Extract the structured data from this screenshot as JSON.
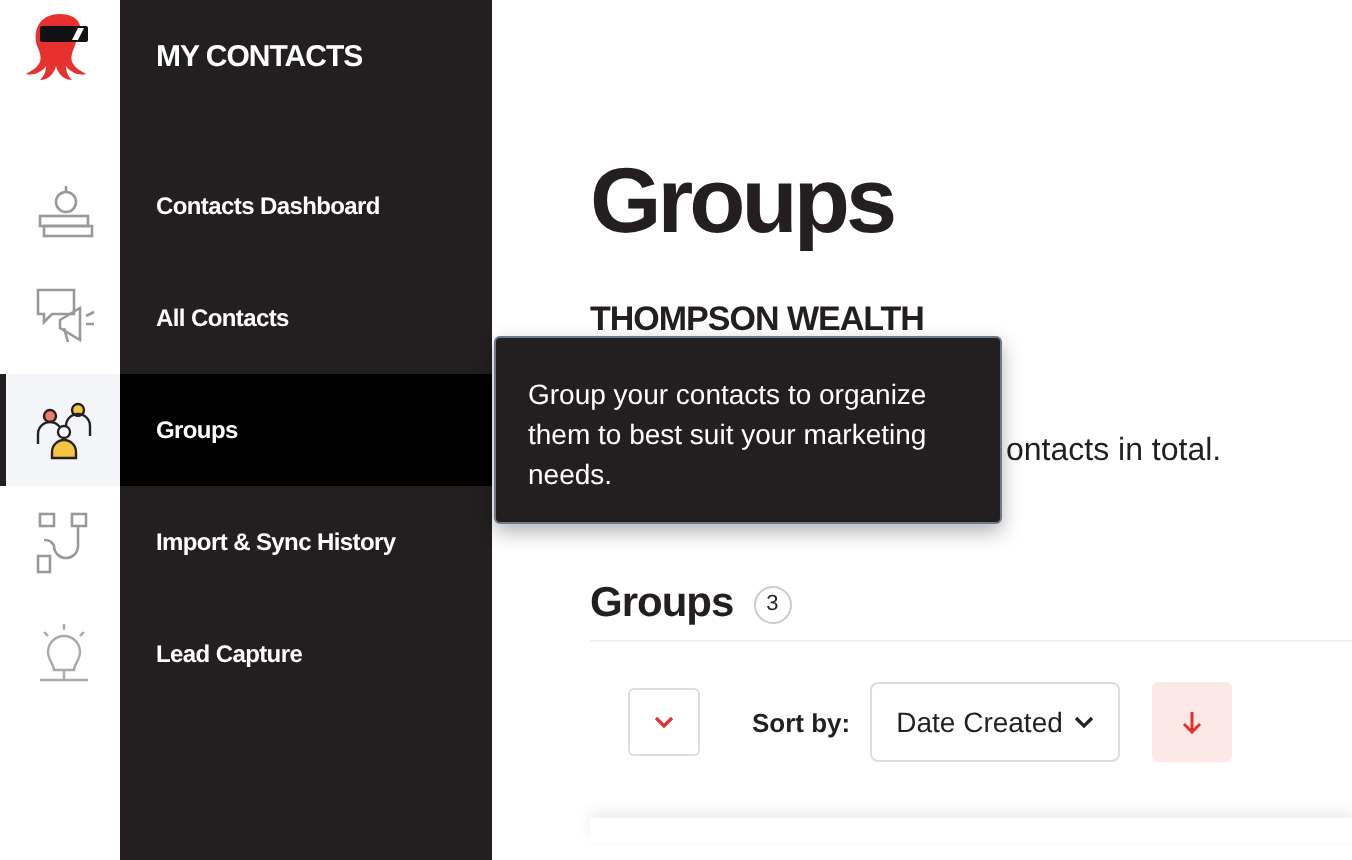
{
  "sidebar": {
    "title": "MY CONTACTS",
    "items": [
      {
        "label": "Contacts Dashboard",
        "selected": false
      },
      {
        "label": "All Contacts",
        "selected": false
      },
      {
        "label": "Groups",
        "selected": true
      },
      {
        "label": "Import & Sync History",
        "selected": false
      },
      {
        "label": "Lead Capture",
        "selected": false
      }
    ]
  },
  "tooltip": {
    "text": "Group your contacts to organize them to best suit your marketing needs."
  },
  "page": {
    "title": "Groups",
    "account": "THOMPSON WEALTH",
    "summary": "ontacts in total."
  },
  "groups": {
    "heading": "Groups",
    "count": "3",
    "sort_label": "Sort by:",
    "sort_value": "Date Created"
  }
}
